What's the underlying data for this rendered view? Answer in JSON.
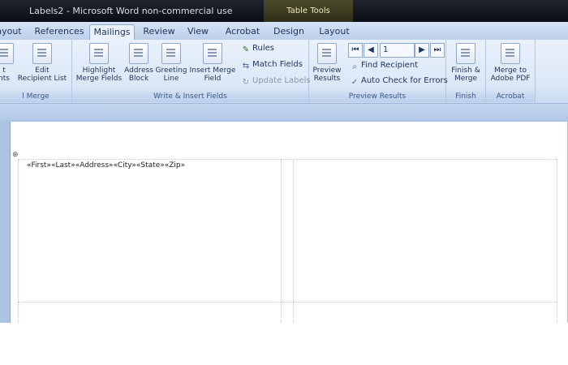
{
  "window": {
    "title": "Labels2 - Microsoft Word non-commercial use",
    "context_tab": "Table Tools"
  },
  "tabs": [
    "ayout",
    "References",
    "Mailings",
    "Review",
    "View",
    "Acrobat",
    "Design",
    "Layout"
  ],
  "active_tab": "Mailings",
  "ribbon": {
    "group_start_mail_merge": {
      "label": "l Merge",
      "btn_start_label": "t\nnts",
      "btn_edit_label": "Edit\nRecipient List"
    },
    "group_write_insert": {
      "label": "Write & Insert Fields",
      "highlight": "Highlight\nMerge Fields",
      "address_block": "Address\nBlock",
      "greeting_line": "Greeting\nLine",
      "insert_merge_field": "Insert Merge\nField",
      "rules": "Rules",
      "match_fields": "Match Fields",
      "update_labels": "Update Labels"
    },
    "group_preview": {
      "label": "Preview Results",
      "preview_results": "Preview\nResults",
      "record_number": "1",
      "find_recipient": "Find Recipient",
      "auto_check": "Auto Check for Errors"
    },
    "group_finish": {
      "label": "Finish",
      "finish_merge": "Finish &\nMerge"
    },
    "group_acrobat": {
      "label": "Acrobat",
      "merge_pdf": "Merge to\nAdobe PDF"
    }
  },
  "document": {
    "merge_fields": "«First»«Last»«Address»«City»«State»«Zip»",
    "table_anchor": "⊕"
  }
}
